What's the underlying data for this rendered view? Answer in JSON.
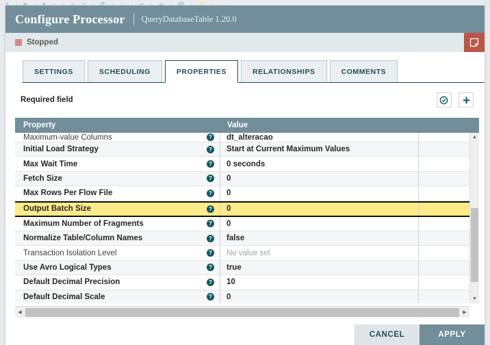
{
  "window": {
    "title": "Configure Processor",
    "subtitle": "QueryDatabaseTable 1.20.0"
  },
  "status": {
    "text": "Stopped",
    "indicator_color": "#cf8b8b",
    "doc_button_icon": "document-icon"
  },
  "tabs": [
    {
      "label": "SETTINGS",
      "active": false
    },
    {
      "label": "SCHEDULING",
      "active": false
    },
    {
      "label": "PROPERTIES",
      "active": true
    },
    {
      "label": "RELATIONSHIPS",
      "active": false
    },
    {
      "label": "COMMENTS",
      "active": false
    }
  ],
  "toolbar": {
    "required_field_label": "Required field",
    "verify_icon": "check-circle-icon",
    "add_icon": "plus-icon"
  },
  "table": {
    "columns": [
      "Property",
      "Value"
    ],
    "rows": [
      {
        "name": "Maximum-value Columns",
        "value": "dt_alteracao",
        "required": false,
        "no_value": false,
        "selected": false,
        "clipped": true
      },
      {
        "name": "Initial Load Strategy",
        "value": "Start at Current Maximum Values",
        "required": true,
        "no_value": false,
        "selected": false,
        "clipped": false
      },
      {
        "name": "Max Wait Time",
        "value": "0 seconds",
        "required": true,
        "no_value": false,
        "selected": false,
        "clipped": false
      },
      {
        "name": "Fetch Size",
        "value": "0",
        "required": true,
        "no_value": false,
        "selected": false,
        "clipped": false
      },
      {
        "name": "Max Rows Per Flow File",
        "value": "0",
        "required": true,
        "no_value": false,
        "selected": false,
        "clipped": false
      },
      {
        "name": "Output Batch Size",
        "value": "0",
        "required": true,
        "no_value": false,
        "selected": true,
        "clipped": false
      },
      {
        "name": "Maximum Number of Fragments",
        "value": "0",
        "required": true,
        "no_value": false,
        "selected": false,
        "clipped": false
      },
      {
        "name": "Normalize Table/Column Names",
        "value": "false",
        "required": true,
        "no_value": false,
        "selected": false,
        "clipped": false
      },
      {
        "name": "Transaction Isolation Level",
        "value": "No value set",
        "required": false,
        "no_value": true,
        "selected": false,
        "clipped": false
      },
      {
        "name": "Use Avro Logical Types",
        "value": "true",
        "required": true,
        "no_value": false,
        "selected": false,
        "clipped": false
      },
      {
        "name": "Default Decimal Precision",
        "value": "10",
        "required": true,
        "no_value": false,
        "selected": false,
        "clipped": false
      },
      {
        "name": "Default Decimal Scale",
        "value": "0",
        "required": true,
        "no_value": false,
        "selected": false,
        "clipped": false
      }
    ],
    "help_glyph": "?"
  },
  "scrollbars": {
    "up_arrow": "▲",
    "down_arrow": "▼",
    "left_arrow": "◀",
    "right_arrow": "▶"
  },
  "footer": {
    "cancel_label": "CANCEL",
    "apply_label": "APPLY"
  },
  "colors": {
    "header_bar": "#728e9b",
    "accent_teal": "#1b4e58",
    "selected_row": "#fdeb89",
    "stopped_red": "#cf8b8b",
    "doc_button_red": "#ba554a"
  }
}
